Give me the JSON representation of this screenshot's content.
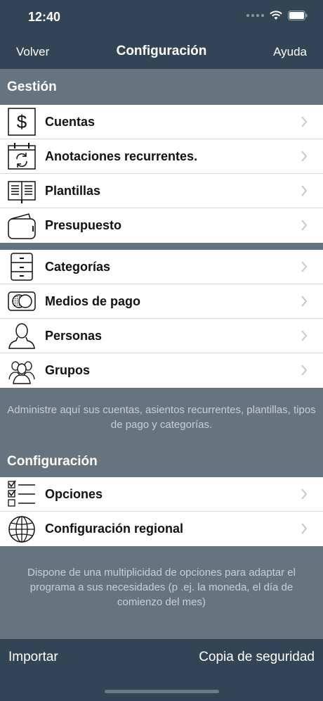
{
  "status_bar": {
    "time": "12:40"
  },
  "nav": {
    "back_label": "Volver",
    "title": "Configuración",
    "help_label": "Ayuda"
  },
  "gestion": {
    "header": "Gestión",
    "items": [
      {
        "label": "Cuentas",
        "icon": "dollar-icon"
      },
      {
        "label": "Anotaciones recurrentes.",
        "icon": "calendar-recurring-icon"
      },
      {
        "label": "Plantillas",
        "icon": "book-icon"
      },
      {
        "label": "Presupuesto",
        "icon": "wallet-icon"
      }
    ],
    "items2": [
      {
        "label": "Categorías",
        "icon": "cabinet-icon"
      },
      {
        "label": "Medios de pago",
        "icon": "payment-card-icon"
      },
      {
        "label": "Personas",
        "icon": "person-icon"
      },
      {
        "label": "Grupos",
        "icon": "group-icon"
      }
    ],
    "note": "Administre aquí sus cuentas, asientos recurrentes, plantillas, tipos de pago y categorías."
  },
  "configuracion": {
    "header": "Configuración",
    "items": [
      {
        "label": "Opciones",
        "icon": "checklist-icon"
      },
      {
        "label": "Configuración regional",
        "icon": "globe-icon"
      }
    ],
    "note": "Dispone de una multiplicidad de opciones para adaptar el programa a sus necesidades (p .ej. la moneda, el día de comienzo del mes)"
  },
  "bottom_bar": {
    "import_label": "Importar",
    "backup_label": "Copia de seguridad"
  }
}
